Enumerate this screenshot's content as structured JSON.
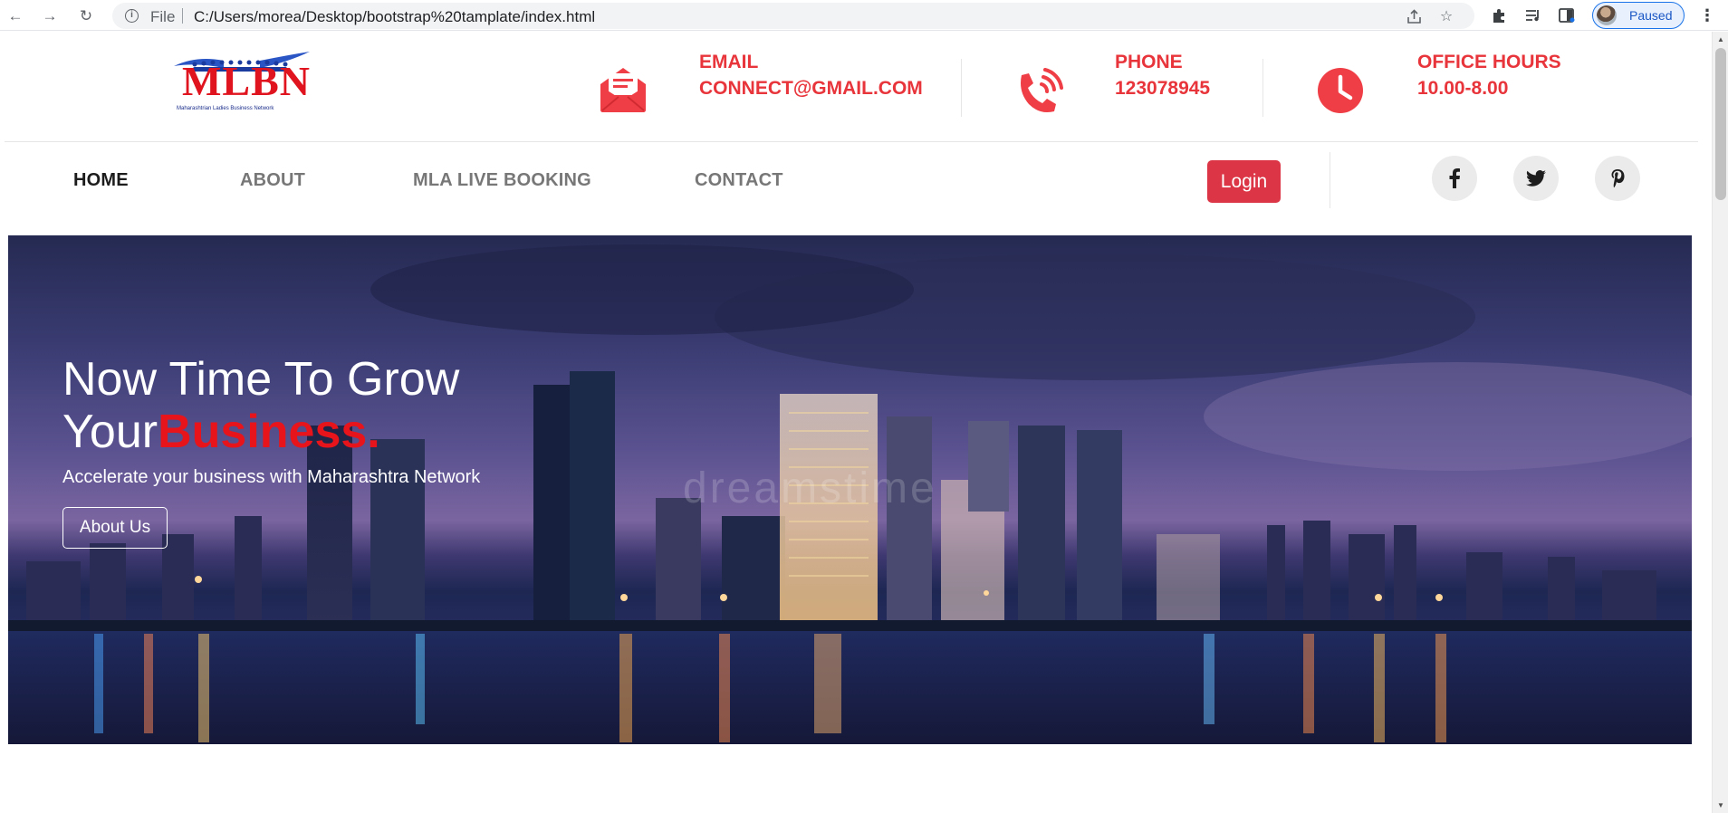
{
  "browser": {
    "scheme": "File",
    "url": "C:/Users/morea/Desktop/bootstrap%20tamplate/index.html",
    "profile_status": "Paused"
  },
  "site": {
    "logo_text": "MLBN",
    "logo_tagline": "Maharashtrian Ladies Business Network"
  },
  "contact": {
    "email": {
      "label": "EMAIL",
      "value": "CONNECT@GMAIL.COM",
      "icon": "mail-icon"
    },
    "phone": {
      "label": "PHONE",
      "value": "123078945",
      "icon": "phone-icon"
    },
    "hours": {
      "label": "OFFICE HOURS",
      "value": "10.00-8.00",
      "icon": "clock-icon"
    }
  },
  "nav": {
    "items": [
      {
        "label": "HOME",
        "active": true
      },
      {
        "label": "ABOUT",
        "active": false
      },
      {
        "label": "MLA LIVE BOOKING",
        "active": false
      },
      {
        "label": "CONTACT",
        "active": false
      }
    ],
    "login_label": "Login",
    "social": [
      "facebook-icon",
      "twitter-icon",
      "pinterest-icon"
    ]
  },
  "hero": {
    "title_line1": "Now Time To Grow",
    "title_line2_a": "Your",
    "title_line2_b": "Business.",
    "subtitle": "Accelerate your business with Maharashtra Network",
    "button_label": "About Us",
    "watermark": "dreamstime"
  },
  "colors": {
    "accent": "#e8343b",
    "login_bg": "#dc3545",
    "highlight": "#e8141b"
  }
}
